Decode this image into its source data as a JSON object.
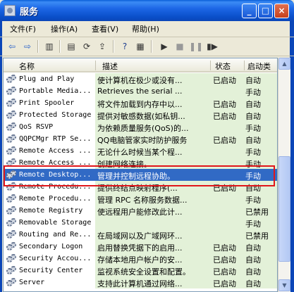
{
  "window": {
    "title": "服务"
  },
  "title_buttons": {
    "minimize": "_",
    "maximize": "□",
    "close": "×"
  },
  "menu": [
    "文件(F)",
    "操作(A)",
    "查看(V)",
    "帮助(H)"
  ],
  "columns": {
    "name": "名称",
    "description": "描述",
    "status": "状态",
    "startup": "启动类型"
  },
  "rows": [
    {
      "name": "Plug and Play",
      "description": "使计算机在极少或没有...",
      "status": "已启动",
      "startup": "自动"
    },
    {
      "name": "Portable Media...",
      "description": "Retrieves the serial ...",
      "status": "",
      "startup": "手动"
    },
    {
      "name": "Print Spooler",
      "description": "将文件加载到内存中以...",
      "status": "已启动",
      "startup": "自动"
    },
    {
      "name": "Protected Storage",
      "description": "提供对敏感数据(如私钥...",
      "status": "已启动",
      "startup": "自动"
    },
    {
      "name": "QoS RSVP",
      "description": "为依赖质量服务(QoS)的...",
      "status": "",
      "startup": "手动"
    },
    {
      "name": "QQPCMgr RTP Se...",
      "description": "QQ电脑管家实时防护服务",
      "status": "已启动",
      "startup": "自动"
    },
    {
      "name": "Remote Access ...",
      "description": "无论什么时候当某个程...",
      "status": "",
      "startup": "手动"
    },
    {
      "name": "Remote Access ...",
      "description": "创建网络连接。",
      "status": "",
      "startup": "手动"
    },
    {
      "name": "Remote Desktop...",
      "description": "管理并控制远程协助。",
      "status": "",
      "startup": "手动"
    },
    {
      "name": "Remote Procedu...",
      "description": "提供终结点映射程序(...",
      "status": "已启动",
      "startup": "自动"
    },
    {
      "name": "Remote Procedu...",
      "description": "管理 RPC 名称服务数据...",
      "status": "",
      "startup": "手动"
    },
    {
      "name": "Remote Registry",
      "description": "使远程用户能修改此计...",
      "status": "",
      "startup": "已禁用"
    },
    {
      "name": "Removable Storage",
      "description": "",
      "status": "",
      "startup": "手动"
    },
    {
      "name": "Routing and Re...",
      "description": "在局域网以及广域网环...",
      "status": "",
      "startup": "已禁用"
    },
    {
      "name": "Secondary Logon",
      "description": "启用替换凭据下的启用...",
      "status": "已启动",
      "startup": "自动"
    },
    {
      "name": "Security Accou...",
      "description": "存储本地用户帐户的安...",
      "status": "已启动",
      "startup": "自动"
    },
    {
      "name": "Security Center",
      "description": "监视系统安全设置和配置。",
      "status": "已启动",
      "startup": "自动"
    },
    {
      "name": "Server",
      "description": "支持此计算机通过网络...",
      "status": "已启动",
      "startup": "自动"
    }
  ],
  "selected_row_index": 8,
  "colors": {
    "selection": "#316ac5",
    "highlight_box": "#e0161b",
    "description_bg": "#e3f1d8"
  }
}
